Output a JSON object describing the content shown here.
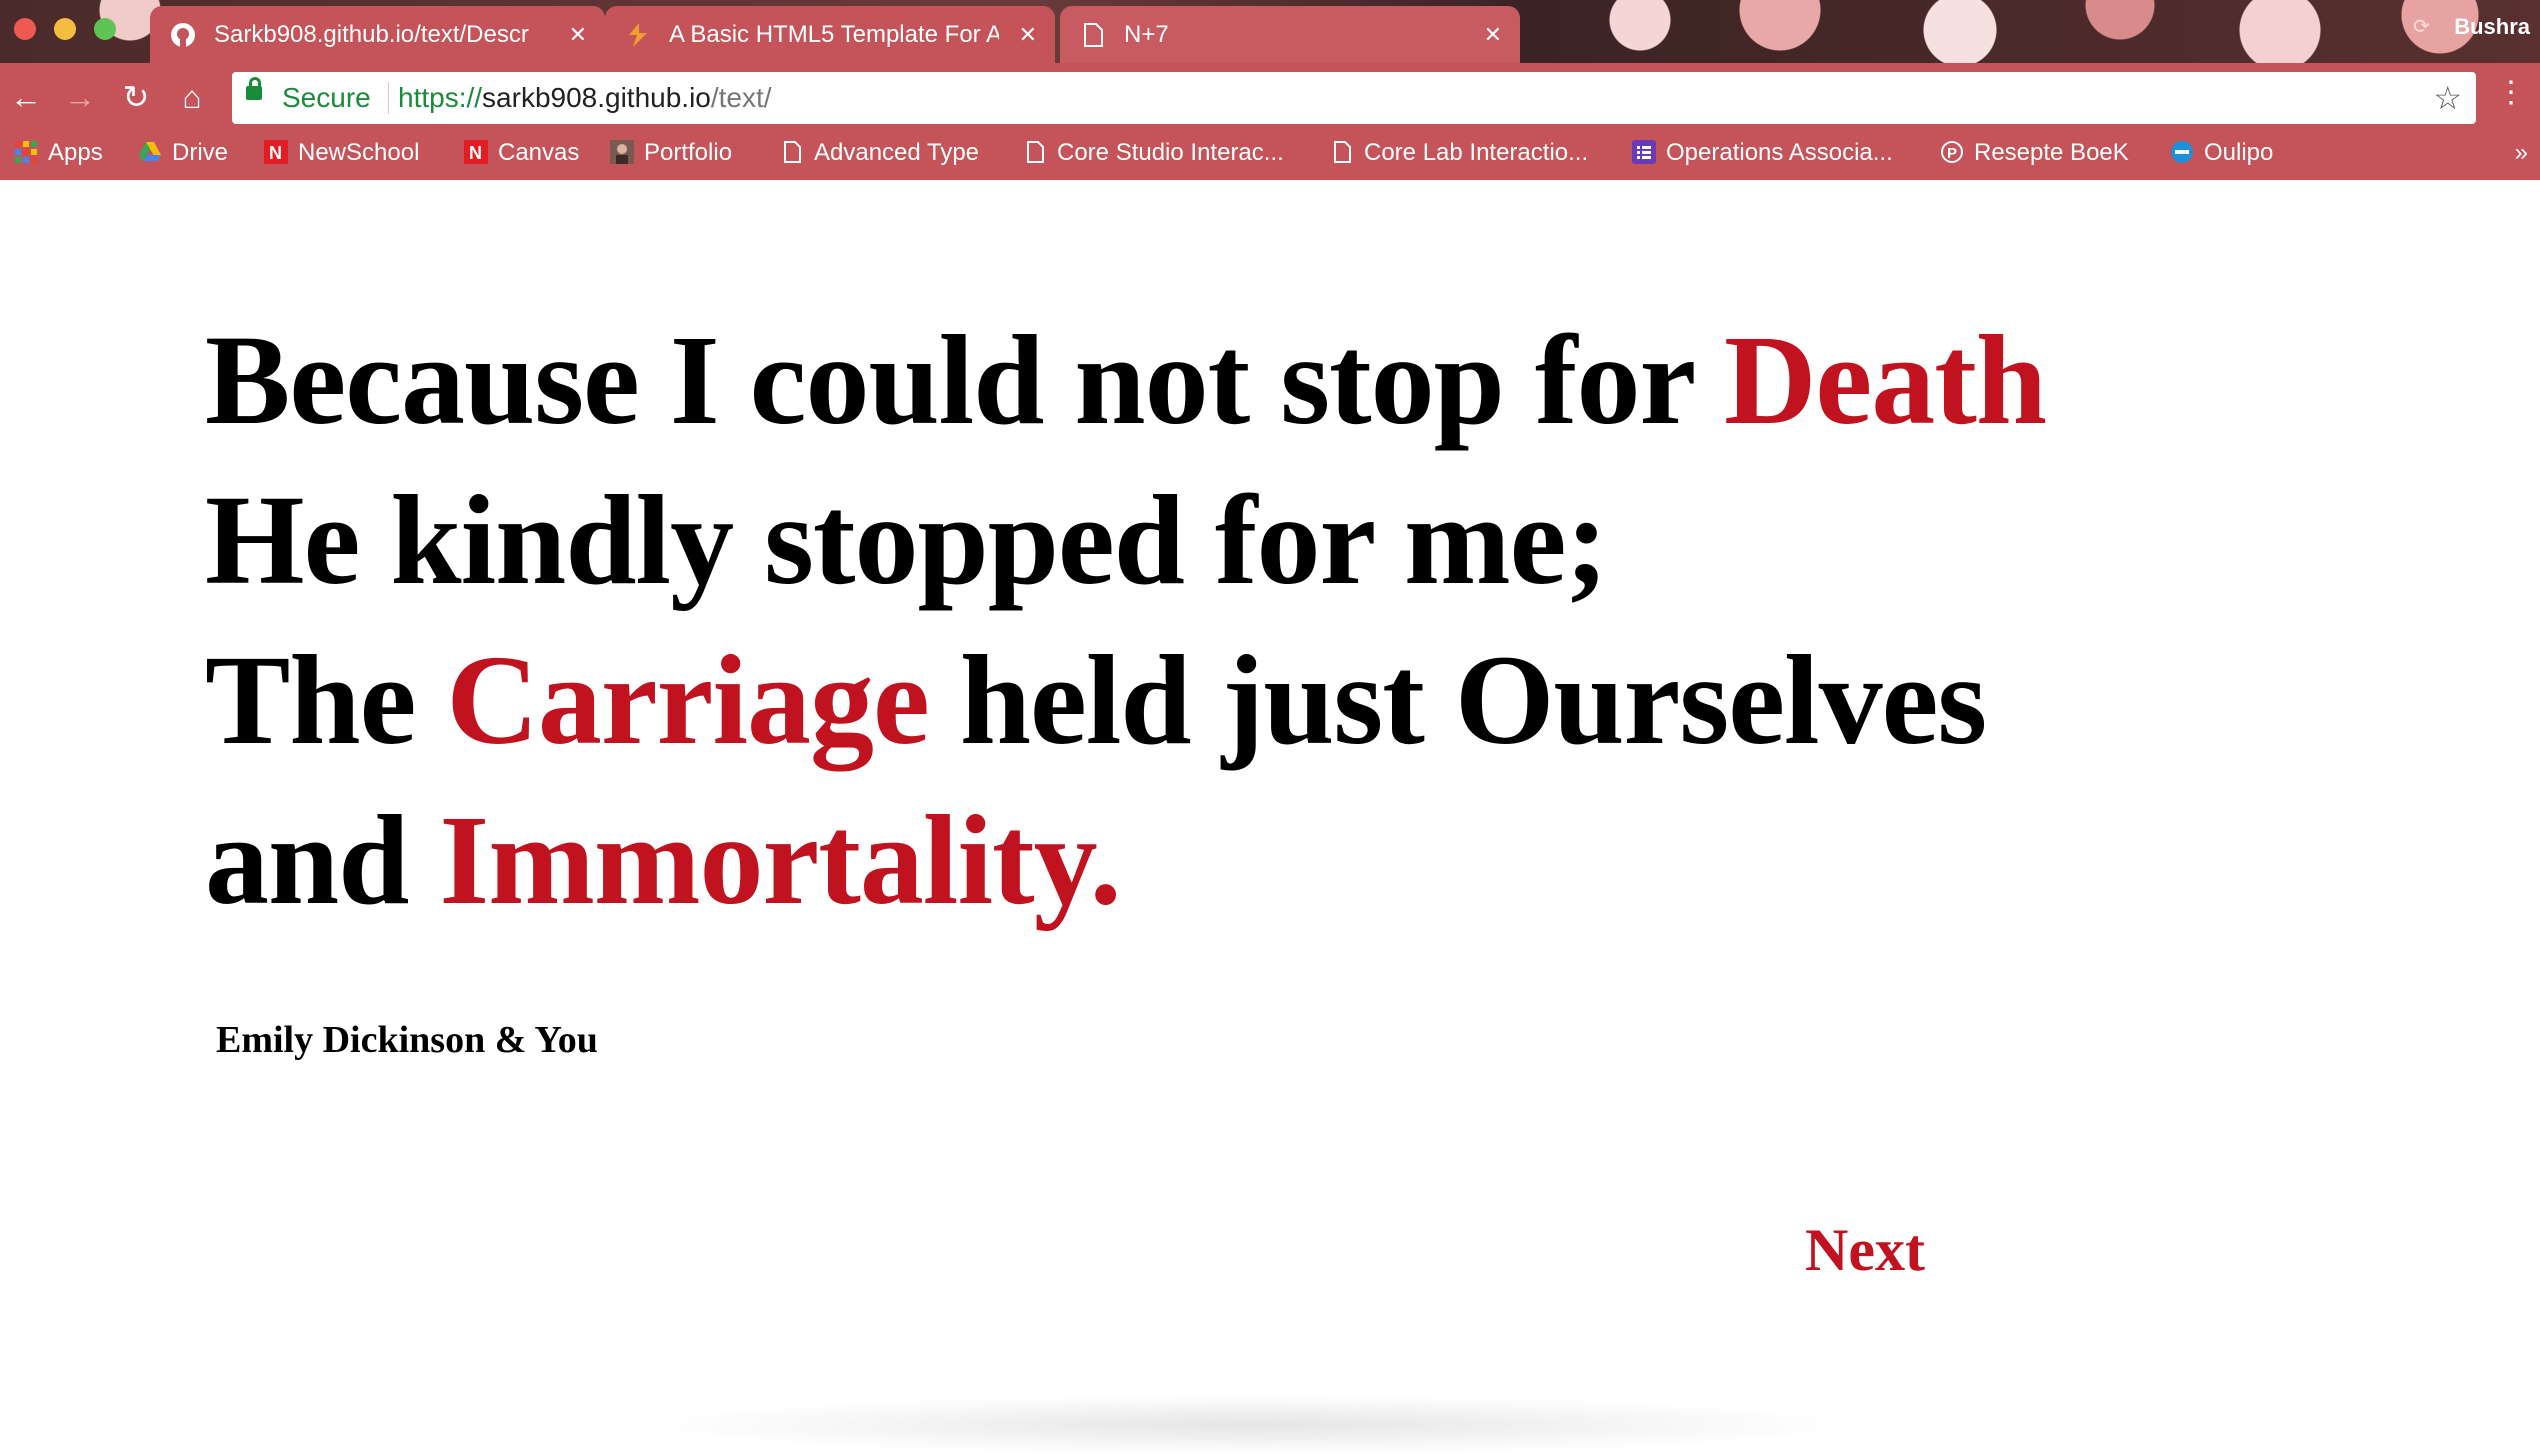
{
  "browser": {
    "tabs": [
      {
        "title": "Sarkb908.github.io/text/Descr",
        "icon": "github-icon"
      },
      {
        "title": "A Basic HTML5 Template For A",
        "icon": "sitepoint-icon"
      },
      {
        "title": "N+7",
        "icon": "page-icon"
      }
    ],
    "profile_name": "Bushra",
    "address": {
      "secure_label": "Secure",
      "scheme": "https://",
      "host": "sarkb908.github.io",
      "path": "/text/"
    },
    "bookmarks": [
      {
        "label": "Apps",
        "icon": "apps-grid-icon"
      },
      {
        "label": "Drive",
        "icon": "google-drive-icon"
      },
      {
        "label": "NewSchool",
        "icon": "newschool-icon"
      },
      {
        "label": "Canvas",
        "icon": "newschool-icon"
      },
      {
        "label": "Portfolio",
        "icon": "portfolio-icon"
      },
      {
        "label": "Advanced Type",
        "icon": "page-icon"
      },
      {
        "label": "Core Studio Interac...",
        "icon": "page-icon"
      },
      {
        "label": "Core Lab Interactio...",
        "icon": "page-icon"
      },
      {
        "label": "Operations Associa...",
        "icon": "forms-icon"
      },
      {
        "label": "Resepte BoeK",
        "icon": "pinterest-icon"
      },
      {
        "label": "Oulipo",
        "icon": "poets-icon"
      }
    ],
    "bookmarks_more": "»"
  },
  "colors": {
    "chrome": "#c4545a",
    "accent_red": "#c0131f",
    "secure_green": "#1a8b3a"
  },
  "poem": {
    "line1_a": "Because I could not stop for ",
    "line1_red": "Death",
    "line2": "He kindly stopped for me;",
    "line3_a": "The ",
    "line3_red": "Carriage",
    "line3_b": " held just Ourselves",
    "line4_a": "and ",
    "line4_red": "Immortality."
  },
  "author": "Emily Dickinson & You",
  "next_label": "Next"
}
